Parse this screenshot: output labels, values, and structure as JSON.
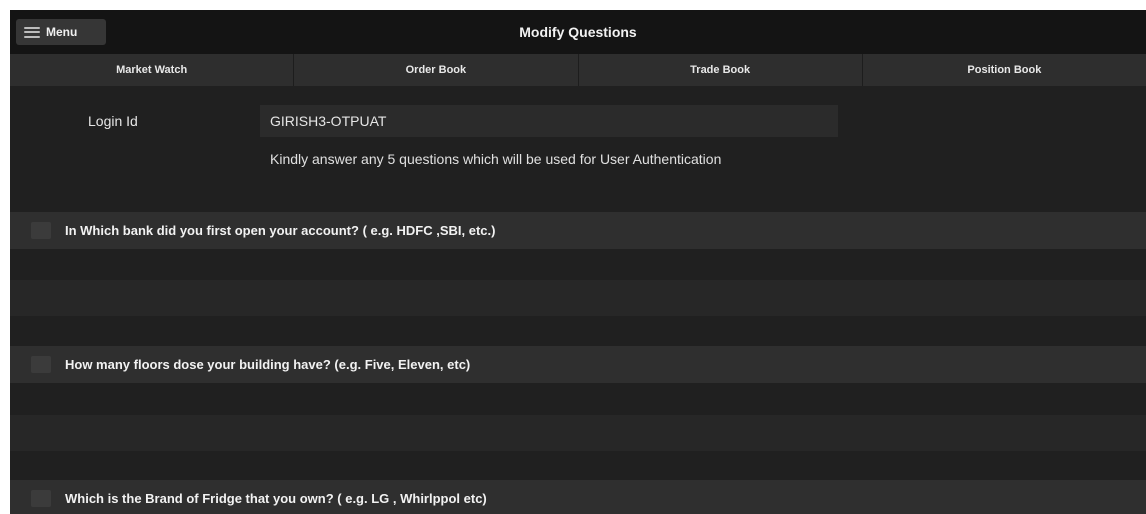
{
  "header": {
    "menu_label": "Menu",
    "title": "Modify Questions"
  },
  "tabs": [
    {
      "label": "Market Watch"
    },
    {
      "label": "Order Book"
    },
    {
      "label": "Trade Book"
    },
    {
      "label": "Position Book"
    }
  ],
  "login": {
    "label": "Login Id",
    "value": "GIRISH3-OTPUAT"
  },
  "instruction": "Kindly answer any 5 questions which will be used for User Authentication",
  "questions": [
    {
      "text": "In Which bank did you first open your account? ( e.g. HDFC ,SBI, etc.)",
      "answer": "",
      "checked": false
    },
    {
      "text": "How many floors dose your building have? (e.g. Five, Eleven, etc)",
      "answer": "",
      "checked": false
    },
    {
      "text": "Which is the Brand of Fridge that you own? ( e.g. LG , Whirlppol etc)",
      "answer": "",
      "checked": false
    }
  ],
  "colors": {
    "background": "#202020",
    "header": "#141414",
    "tab_bar": "#2e2e2e",
    "question_row": "#2f2f2f",
    "answer_field": "#272727",
    "text": "#e6e6e6"
  },
  "icons": {
    "menu": "hamburger-icon"
  }
}
